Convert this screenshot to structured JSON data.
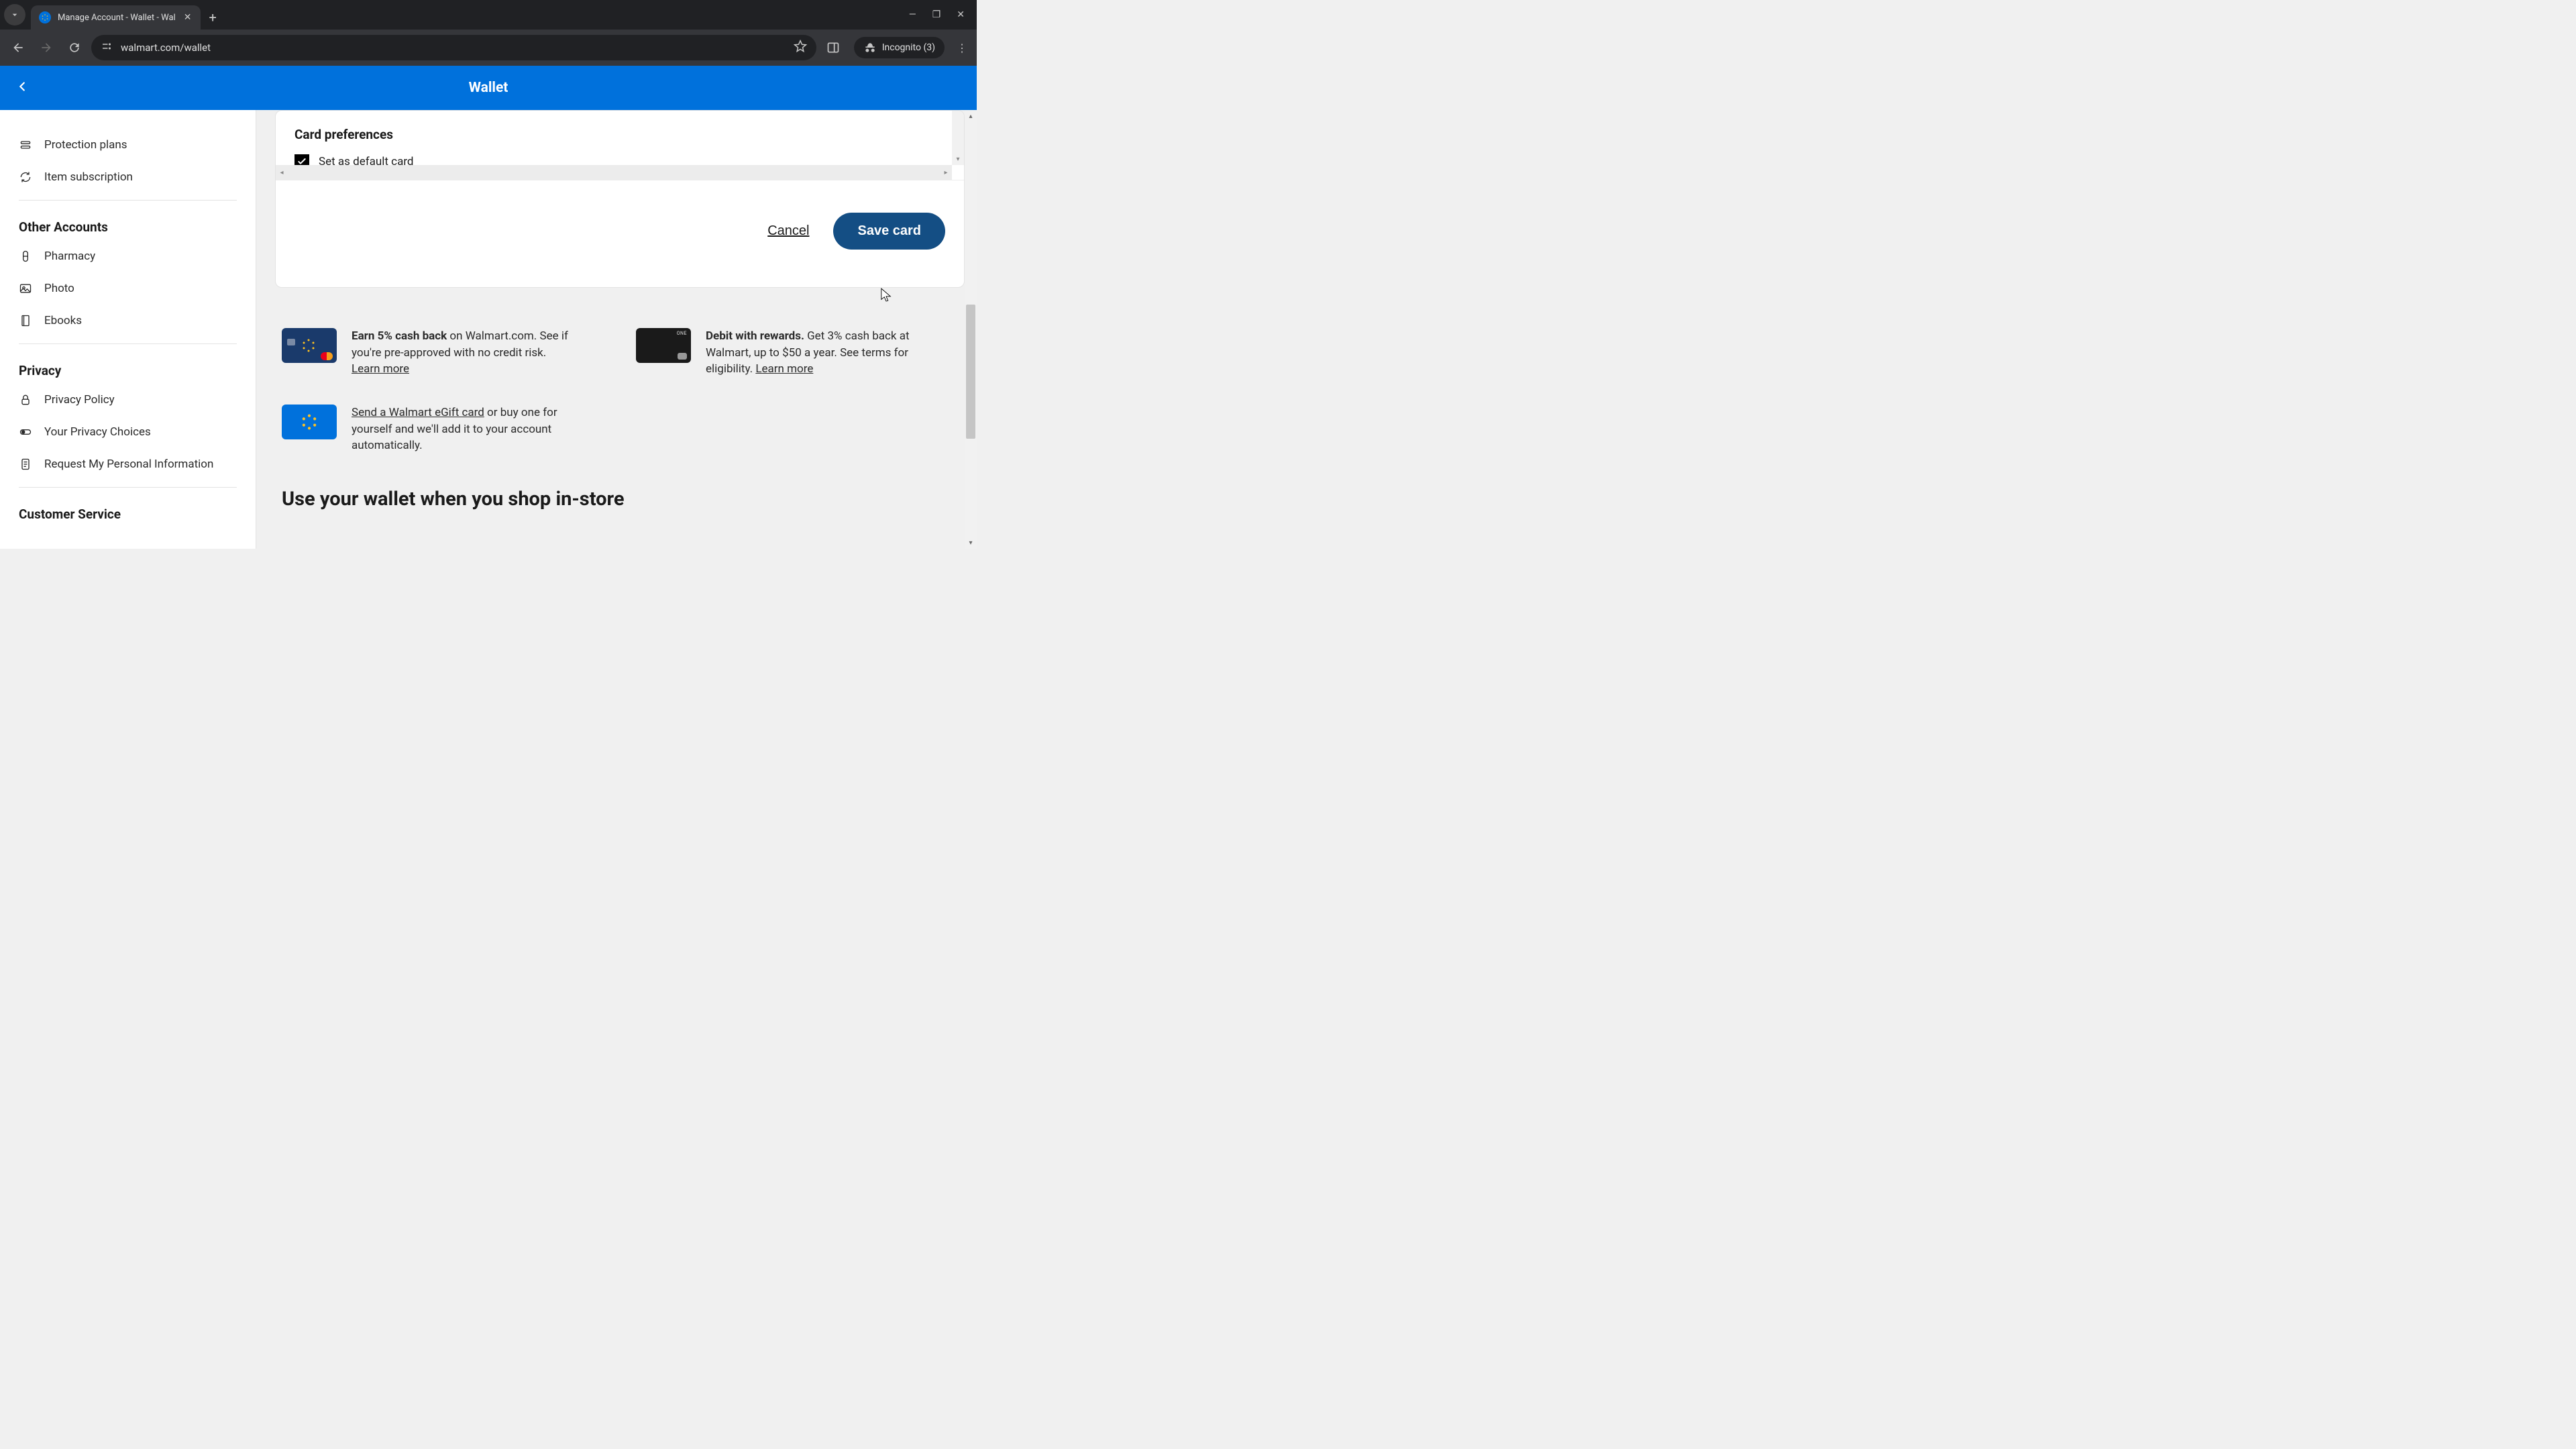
{
  "browser": {
    "tab_title": "Manage Account - Wallet - Wal",
    "url": "walmart.com/wallet",
    "incognito_label": "Incognito (3)"
  },
  "header": {
    "title": "Wallet"
  },
  "sidebar": {
    "items_top": [
      {
        "label": "Protection plans"
      },
      {
        "label": "Item subscription"
      }
    ],
    "other_accounts_heading": "Other Accounts",
    "other_accounts": [
      {
        "label": "Pharmacy"
      },
      {
        "label": "Photo"
      },
      {
        "label": "Ebooks"
      }
    ],
    "privacy_heading": "Privacy",
    "privacy_items": [
      {
        "label": "Privacy Policy"
      },
      {
        "label": "Your Privacy Choices"
      },
      {
        "label": "Request My Personal Information"
      }
    ],
    "cs_heading": "Customer Service"
  },
  "card_panel": {
    "title": "Card preferences",
    "checkbox_label": "Set as default card",
    "cancel": "Cancel",
    "save": "Save card"
  },
  "promos": {
    "p1_bold": "Earn 5% cash back",
    "p1_rest": " on Walmart.com. See if you're pre-approved with no credit risk.",
    "p1_link": "Learn more",
    "p2_bold": "Debit with rewards.",
    "p2_rest": " Get 3% cash back at Walmart, up to $50 a year. See terms for eligibility. ",
    "p2_link": "Learn more",
    "p3_link": "Send a Walmart eGift card",
    "p3_rest": " or buy one for yourself and we'll add it to your account automatically."
  },
  "instore_heading": "Use your wallet when you shop in-store"
}
